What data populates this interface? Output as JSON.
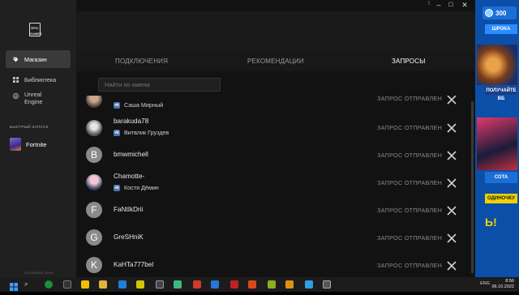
{
  "sidebar": {
    "logo_text": "EPIC GAMES",
    "items": [
      {
        "label": "Магазин",
        "icon": "tag-icon"
      },
      {
        "label": "Библиотека",
        "icon": "grid-icon"
      },
      {
        "label_line1": "Unreal",
        "label_line2": "Engine",
        "icon": "unreal-icon"
      }
    ],
    "quick_launch_title": "БЫСТРЫЙ ЗАПУСК",
    "quick_launch_game": "Fortnite",
    "footer_text": "UN PRIVATE: 100%"
  },
  "tabs": [
    "ПОДКЛЮЧЕНИЯ",
    "РЕКОМЕНДАЦИИ",
    "ЗАПРОСЫ"
  ],
  "search": {
    "placeholder": "Найти по имени"
  },
  "status_text": "ЗАПРОС ОТПРАВЛЕН",
  "requests": [
    {
      "name": "",
      "vk_name": "Саша Мирный",
      "avatar_letter": "",
      "avatar": "photo"
    },
    {
      "name": "barakuda78",
      "vk_name": "Витвлик Груздев",
      "avatar_letter": "",
      "avatar": "photo"
    },
    {
      "name": "bmwmichell",
      "vk_name": "",
      "avatar_letter": "B",
      "avatar": "letter"
    },
    {
      "name": "Chamotte-",
      "vk_name": "Костя Дёмин",
      "avatar_letter": "",
      "avatar": "photo"
    },
    {
      "name": "FaNtIkDrii",
      "vk_name": "",
      "avatar_letter": "F",
      "avatar": "letter"
    },
    {
      "name": "GreSHniK",
      "vk_name": "",
      "avatar_letter": "G",
      "avatar": "letter"
    },
    {
      "name": "KaHTa777bel",
      "vk_name": "",
      "avatar_letter": "K",
      "avatar": "letter"
    }
  ],
  "right_panel": {
    "vbucks": "300",
    "banners": [
      "ШРОКА",
      "ПОЛУЧАЙТЕ ВБ",
      "СОТА",
      "ОДИНОЧКУ",
      "Ь!"
    ]
  },
  "taskbar": {
    "lang": "ENG",
    "time": "8:56",
    "date": "06.10.2022"
  },
  "colors": {
    "background": "#121212",
    "sidebar": "#202020",
    "vk_blue": "#4a76a8",
    "right_panel_blue": "#0b4fa8"
  }
}
